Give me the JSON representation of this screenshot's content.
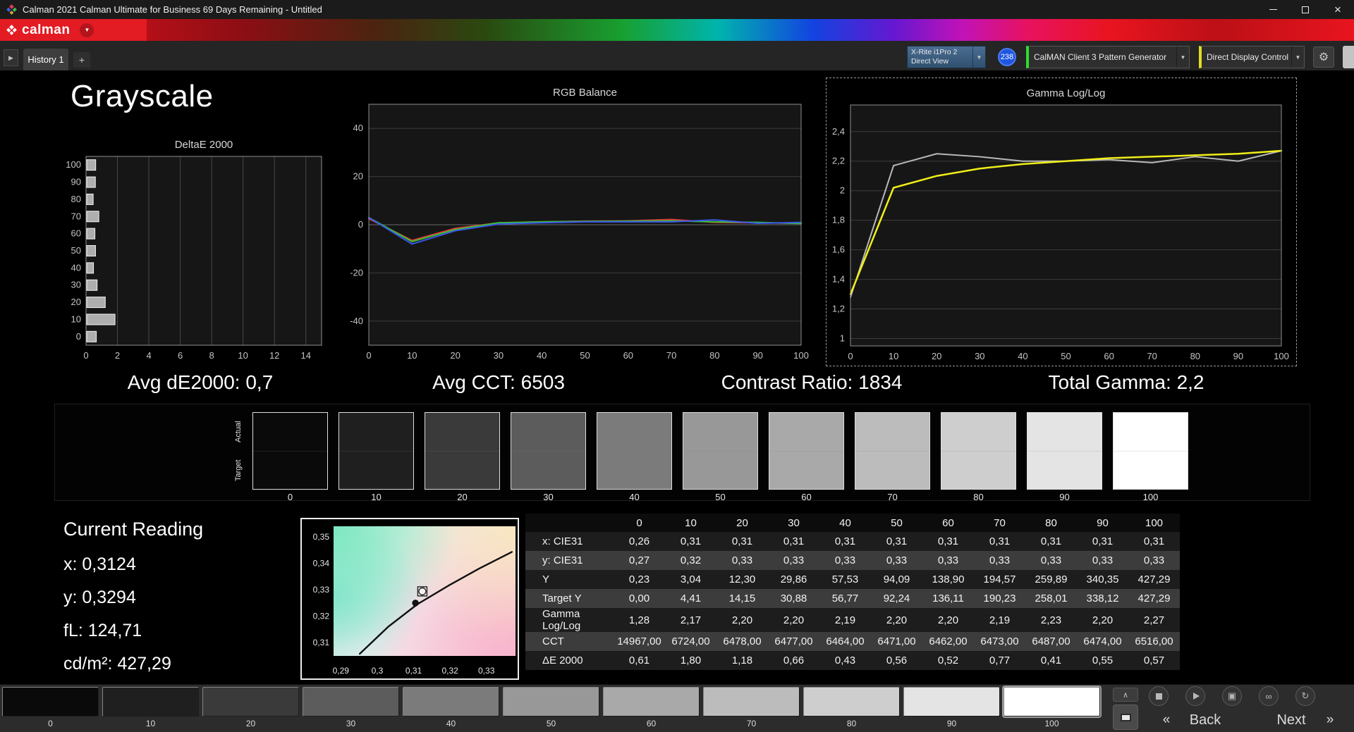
{
  "window": {
    "title": "Calman 2021 Calman Ultimate for Business 69 Days Remaining  - Untitled"
  },
  "brand": {
    "logo_text": "calman"
  },
  "tabbar": {
    "history_tab": "History 1",
    "add_tab": "+"
  },
  "devices": {
    "meter": {
      "line1": "X-Rite i1Pro 2",
      "line2": "Direct View",
      "badge": "238"
    },
    "pattern_source": {
      "label": "CalMAN Client 3 Pattern Generator"
    },
    "display_control": {
      "label": "Direct Display Control"
    }
  },
  "page": {
    "title": "Grayscale"
  },
  "stats": {
    "avg_de2000": "Avg dE2000: 0,7",
    "avg_cct": "Avg CCT: 6503",
    "contrast_ratio": "Contrast Ratio: 1834",
    "total_gamma": "Total Gamma: 2,2"
  },
  "grayscale_strip": {
    "row_labels": [
      "Actual",
      "Target"
    ],
    "levels": [
      {
        "label": "0",
        "color": "#0a0a0a"
      },
      {
        "label": "10",
        "color": "#1f1f1f"
      },
      {
        "label": "20",
        "color": "#3a3a3a"
      },
      {
        "label": "30",
        "color": "#5c5c5c"
      },
      {
        "label": "40",
        "color": "#7b7b7b"
      },
      {
        "label": "50",
        "color": "#989898"
      },
      {
        "label": "60",
        "color": "#a9a9a9"
      },
      {
        "label": "70",
        "color": "#bcbcbc"
      },
      {
        "label": "80",
        "color": "#cecece"
      },
      {
        "label": "90",
        "color": "#e4e4e4"
      },
      {
        "label": "100",
        "color": "#ffffff"
      }
    ]
  },
  "current_reading": {
    "title": "Current Reading",
    "x": "x: 0,3124",
    "y": "y: 0,3294",
    "fl": "fL: 124,71",
    "cdm2": "cd/m²: 427,29"
  },
  "cie_chart": {
    "xlim": [
      0.288,
      0.338
    ],
    "ylim": [
      0.305,
      0.354
    ],
    "xticks": [
      {
        "v": 0.29,
        "label": "0,29"
      },
      {
        "v": 0.3,
        "label": "0,3"
      },
      {
        "v": 0.31,
        "label": "0,31"
      },
      {
        "v": 0.32,
        "label": "0,32"
      },
      {
        "v": 0.33,
        "label": "0,33"
      }
    ],
    "yticks": [
      {
        "v": 0.35,
        "label": "0,35"
      },
      {
        "v": 0.34,
        "label": "0,34"
      },
      {
        "v": 0.33,
        "label": "0,33"
      },
      {
        "v": 0.32,
        "label": "0,32"
      },
      {
        "v": 0.31,
        "label": "0,31"
      }
    ],
    "locus": [
      [
        0.2952,
        0.3058
      ],
      [
        0.303,
        0.316
      ],
      [
        0.311,
        0.3245
      ],
      [
        0.3195,
        0.3315
      ],
      [
        0.328,
        0.338
      ],
      [
        0.337,
        0.3443
      ]
    ],
    "reading_point": [
      0.3105,
      0.325
    ],
    "target_marker": [
      0.3124,
      0.3294
    ]
  },
  "results_table": {
    "columns": [
      "0",
      "10",
      "20",
      "30",
      "40",
      "50",
      "60",
      "70",
      "80",
      "90",
      "100"
    ],
    "rows": [
      {
        "label": "x: CIE31",
        "values": [
          "0,26",
          "0,31",
          "0,31",
          "0,31",
          "0,31",
          "0,31",
          "0,31",
          "0,31",
          "0,31",
          "0,31",
          "0,31"
        ]
      },
      {
        "label": "y: CIE31",
        "values": [
          "0,27",
          "0,32",
          "0,33",
          "0,33",
          "0,33",
          "0,33",
          "0,33",
          "0,33",
          "0,33",
          "0,33",
          "0,33"
        ]
      },
      {
        "label": "Y",
        "values": [
          "0,23",
          "3,04",
          "12,30",
          "29,86",
          "57,53",
          "94,09",
          "138,90",
          "194,57",
          "259,89",
          "340,35",
          "427,29"
        ]
      },
      {
        "label": "Target Y",
        "values": [
          "0,00",
          "4,41",
          "14,15",
          "30,88",
          "56,77",
          "92,24",
          "136,11",
          "190,23",
          "258,01",
          "338,12",
          "427,29"
        ]
      },
      {
        "label": "Gamma Log/Log",
        "values": [
          "1,28",
          "2,17",
          "2,20",
          "2,20",
          "2,19",
          "2,20",
          "2,20",
          "2,19",
          "2,23",
          "2,20",
          "2,27"
        ]
      },
      {
        "label": "CCT",
        "values": [
          "14967,00",
          "6724,00",
          "6478,00",
          "6477,00",
          "6464,00",
          "6471,00",
          "6462,00",
          "6473,00",
          "6487,00",
          "6474,00",
          "6516,00"
        ]
      },
      {
        "label": "ΔE 2000",
        "values": [
          "0,61",
          "1,80",
          "1,18",
          "0,66",
          "0,43",
          "0,56",
          "0,52",
          "0,77",
          "0,41",
          "0,55",
          "0,57"
        ]
      }
    ]
  },
  "chart_data": [
    {
      "id": "deltae2000",
      "type": "bar",
      "orientation": "horizontal",
      "title": "DeltaE 2000",
      "categories": [
        "100",
        "90",
        "80",
        "70",
        "60",
        "50",
        "40",
        "30",
        "20",
        "10",
        "0"
      ],
      "values": [
        0.57,
        0.55,
        0.41,
        0.77,
        0.52,
        0.56,
        0.43,
        0.66,
        1.18,
        1.8,
        0.61
      ],
      "xlim": [
        0,
        15
      ],
      "xticks": [
        {
          "v": 0,
          "label": "0"
        },
        {
          "v": 2,
          "label": "2"
        },
        {
          "v": 4,
          "label": "4"
        },
        {
          "v": 6,
          "label": "6"
        },
        {
          "v": 8,
          "label": "8"
        },
        {
          "v": 10,
          "label": "10"
        },
        {
          "v": 12,
          "label": "12"
        },
        {
          "v": 14,
          "label": "14"
        }
      ],
      "bar_fill": "#aeaeae",
      "bar_stroke": "#f2f2f2"
    },
    {
      "id": "rgb-balance",
      "type": "line",
      "title": "RGB Balance",
      "x": [
        0,
        10,
        20,
        30,
        40,
        50,
        60,
        70,
        80,
        90,
        100
      ],
      "xlim": [
        0,
        100
      ],
      "ylim": [
        -50,
        50
      ],
      "xticks": [
        {
          "v": 0,
          "label": "0"
        },
        {
          "v": 10,
          "label": "10"
        },
        {
          "v": 20,
          "label": "20"
        },
        {
          "v": 30,
          "label": "30"
        },
        {
          "v": 40,
          "label": "40"
        },
        {
          "v": 50,
          "label": "50"
        },
        {
          "v": 60,
          "label": "60"
        },
        {
          "v": 70,
          "label": "70"
        },
        {
          "v": 80,
          "label": "80"
        },
        {
          "v": 90,
          "label": "90"
        },
        {
          "v": 100,
          "label": "100"
        }
      ],
      "yticks": [
        {
          "v": 40,
          "label": "40"
        },
        {
          "v": 20,
          "label": "20"
        },
        {
          "v": 0,
          "label": "0"
        },
        {
          "v": -20,
          "label": "-20"
        },
        {
          "v": -40,
          "label": "-40"
        }
      ],
      "series": [
        {
          "name": "Red",
          "color": "#e03a3a",
          "width": 2,
          "values": [
            2.5,
            -6.5,
            -1.5,
            0.8,
            1.2,
            1.5,
            1.6,
            2.2,
            1.0,
            0.8,
            0.6
          ]
        },
        {
          "name": "Green",
          "color": "#35c435",
          "width": 2,
          "values": [
            3.0,
            -7.0,
            -2.0,
            0.8,
            1.2,
            1.4,
            1.5,
            1.6,
            1.2,
            1.0,
            0.5
          ]
        },
        {
          "name": "Blue",
          "color": "#3a55e8",
          "width": 2,
          "values": [
            3.0,
            -8.0,
            -2.5,
            0.3,
            0.8,
            1.2,
            1.2,
            1.2,
            2.0,
            0.6,
            1.0
          ]
        }
      ]
    },
    {
      "id": "gamma-loglog",
      "type": "line",
      "title": "Gamma Log/Log",
      "x": [
        0,
        10,
        20,
        30,
        40,
        50,
        60,
        70,
        80,
        90,
        100
      ],
      "xlim": [
        0,
        100
      ],
      "ylim": [
        0.95,
        2.58
      ],
      "xticks": [
        {
          "v": 0,
          "label": "0"
        },
        {
          "v": 10,
          "label": "10"
        },
        {
          "v": 20,
          "label": "20"
        },
        {
          "v": 30,
          "label": "30"
        },
        {
          "v": 40,
          "label": "40"
        },
        {
          "v": 50,
          "label": "50"
        },
        {
          "v": 60,
          "label": "60"
        },
        {
          "v": 70,
          "label": "70"
        },
        {
          "v": 80,
          "label": "80"
        },
        {
          "v": 90,
          "label": "90"
        },
        {
          "v": 100,
          "label": "100"
        }
      ],
      "yticks": [
        {
          "v": 2.4,
          "label": "2,4"
        },
        {
          "v": 2.2,
          "label": "2,2"
        },
        {
          "v": 2.0,
          "label": "2"
        },
        {
          "v": 1.8,
          "label": "1,8"
        },
        {
          "v": 1.6,
          "label": "1,6"
        },
        {
          "v": 1.4,
          "label": "1,4"
        },
        {
          "v": 1.2,
          "label": "1,2"
        },
        {
          "v": 1.0,
          "label": "1"
        }
      ],
      "series": [
        {
          "name": "Measured",
          "color": "#b8b8b8",
          "width": 2,
          "values": [
            1.28,
            2.17,
            2.25,
            2.23,
            2.2,
            2.2,
            2.21,
            2.19,
            2.23,
            2.2,
            2.27
          ]
        },
        {
          "name": "Target",
          "color": "#f0ee18",
          "width": 2.5,
          "values": [
            1.3,
            2.02,
            2.1,
            2.15,
            2.18,
            2.2,
            2.22,
            2.23,
            2.24,
            2.25,
            2.27
          ]
        }
      ]
    }
  ],
  "pattern_bar": {
    "selected": "100"
  },
  "nav": {
    "back_chevron": "«",
    "back": "Back",
    "next": "Next",
    "next_chevron": "»"
  }
}
